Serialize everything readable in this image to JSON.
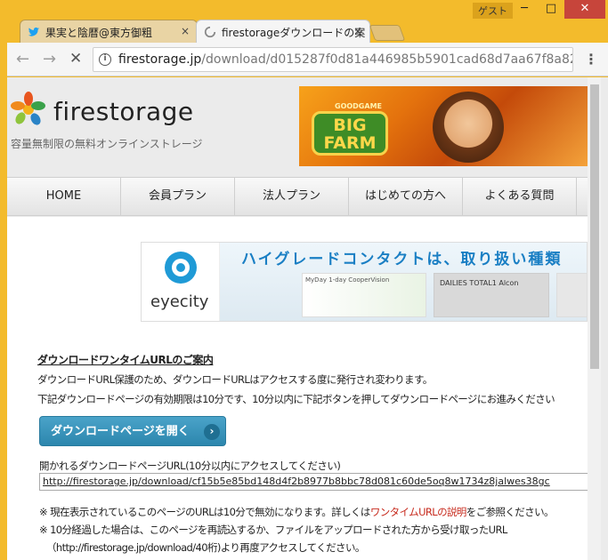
{
  "window": {
    "guest_label": "ゲスト",
    "minimize_label": "─",
    "maximize_label": "□",
    "close_label": "✕"
  },
  "tabs": [
    {
      "title": "果実と陰暦@東方御粗",
      "close": "×"
    },
    {
      "title": "firestorageダウンロードの案",
      "close": "×"
    }
  ],
  "toolbar": {
    "url_host": "firestorage.jp",
    "url_path": "/download/d015287f0d81a446985b5901cad68d7aa67f8a82",
    "info_glyph": "i",
    "menu_glyph": "⋮",
    "back_glyph": "←",
    "forward_glyph": "→",
    "stop_glyph": "✕"
  },
  "site": {
    "logo_text": "firestorage",
    "tagline": "容量無制限の無料オンラインストレージ",
    "banner": {
      "brand_small": "GOODGAME",
      "brand_big": "BIG FARM"
    },
    "nav": [
      "HOME",
      "会員プラン",
      "法人プラン",
      "はじめての方へ",
      "よくある質問"
    ]
  },
  "ad": {
    "brand": "eyecity",
    "headline": "ハイグレードコンタクトは、取り扱い種類",
    "product1": "MyDay 1-day CooperVision",
    "product2": "DAILIES TOTAL1 Alcon"
  },
  "content": {
    "title": "ダウンロードワンタイムURLのご案内",
    "line1": "ダウンロードURL保護のため、ダウンロードURLはアクセスする度に発行され変わります。",
    "line2": "下記ダウンロードページの有効期限は10分です、10分以内に下記ボタンを押してダウンロードページにお進みください",
    "button_label": "ダウンロードページを開く",
    "button_chevron": "›",
    "url_label": "開かれるダウンロードページURL(10分以内にアクセスしてください)",
    "url_value": "http://firestorage.jp/download/cf15b5e85bd148d4f2b8977b8bbc78d081c60de5oq8w1734z8jalwes38gc",
    "note1_prefix": "※ 現在表示されているこのページのURLは10分で無効になります。詳しくは",
    "note1_link": "ワンタイムURLの説明",
    "note1_suffix": "をご参照ください。",
    "note2": "※ 10分経過した場合は、このページを再読込するか、ファイルをアップロードされた方から受け取ったURL",
    "note3": "（http://firestorage.jp/download/40桁)より再度アクセスしてください。"
  }
}
